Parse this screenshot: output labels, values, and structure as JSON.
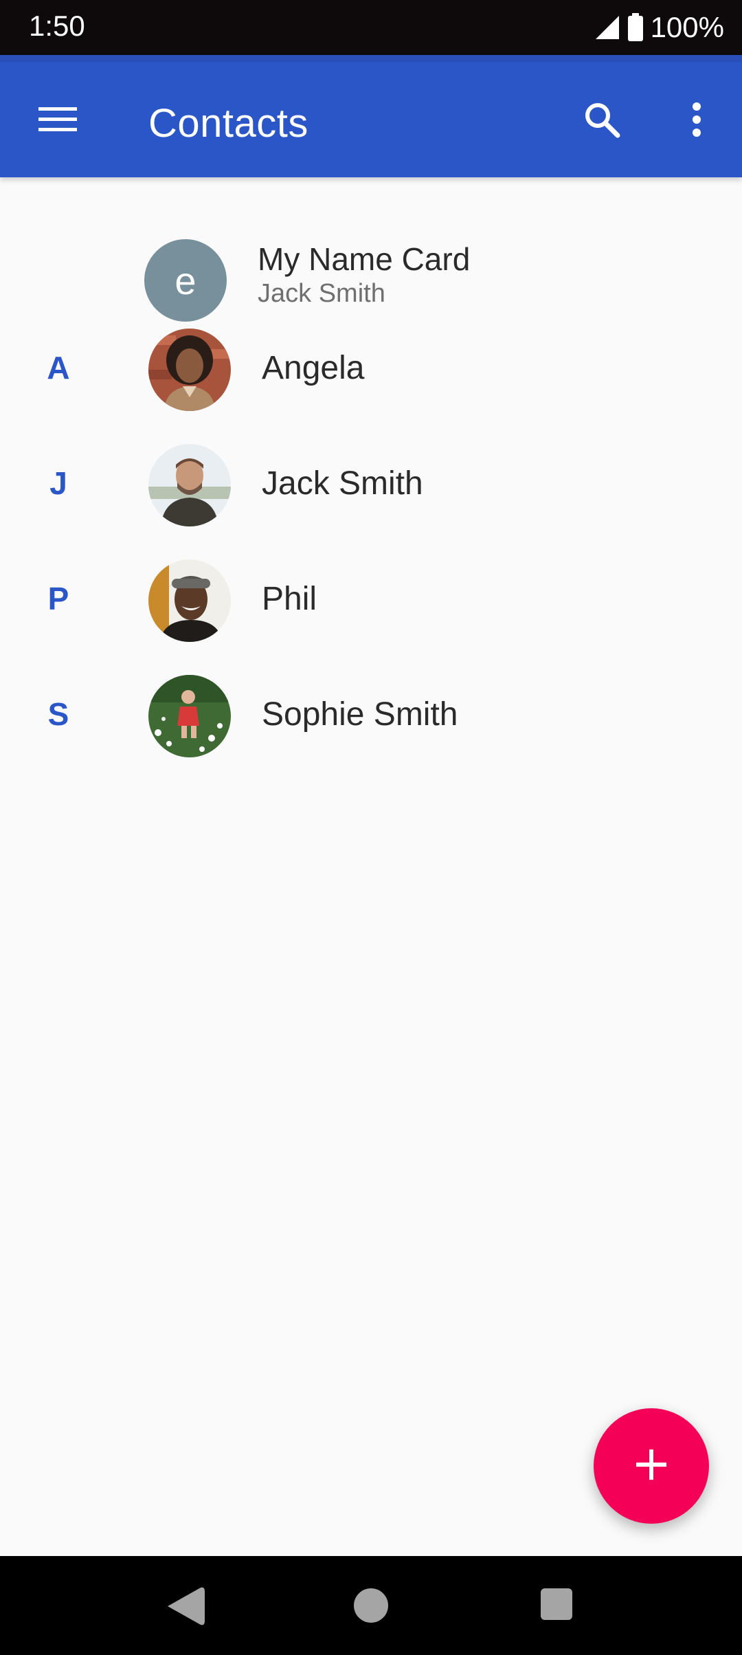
{
  "status_bar": {
    "time": "1:50",
    "battery_text": "100%",
    "icons": [
      "signal-icon",
      "battery-icon"
    ]
  },
  "app_bar": {
    "title": "Contacts",
    "icons": [
      "menu-icon",
      "search-icon",
      "more-vert-icon"
    ],
    "color": "#2b56c7"
  },
  "name_card": {
    "title": "My Name Card",
    "subtitle": "Jack Smith",
    "avatar_letter": "e",
    "avatar_color": "#78909c"
  },
  "contacts": [
    {
      "section": "A",
      "name": "Angela"
    },
    {
      "section": "J",
      "name": "Jack Smith"
    },
    {
      "section": "P",
      "name": "Phil"
    },
    {
      "section": "S",
      "name": "Sophie Smith"
    }
  ],
  "fab": {
    "icon": "add-icon",
    "color": "#f50057"
  },
  "nav_bar": {
    "icons": [
      "back-icon",
      "home-icon",
      "recents-icon"
    ]
  }
}
